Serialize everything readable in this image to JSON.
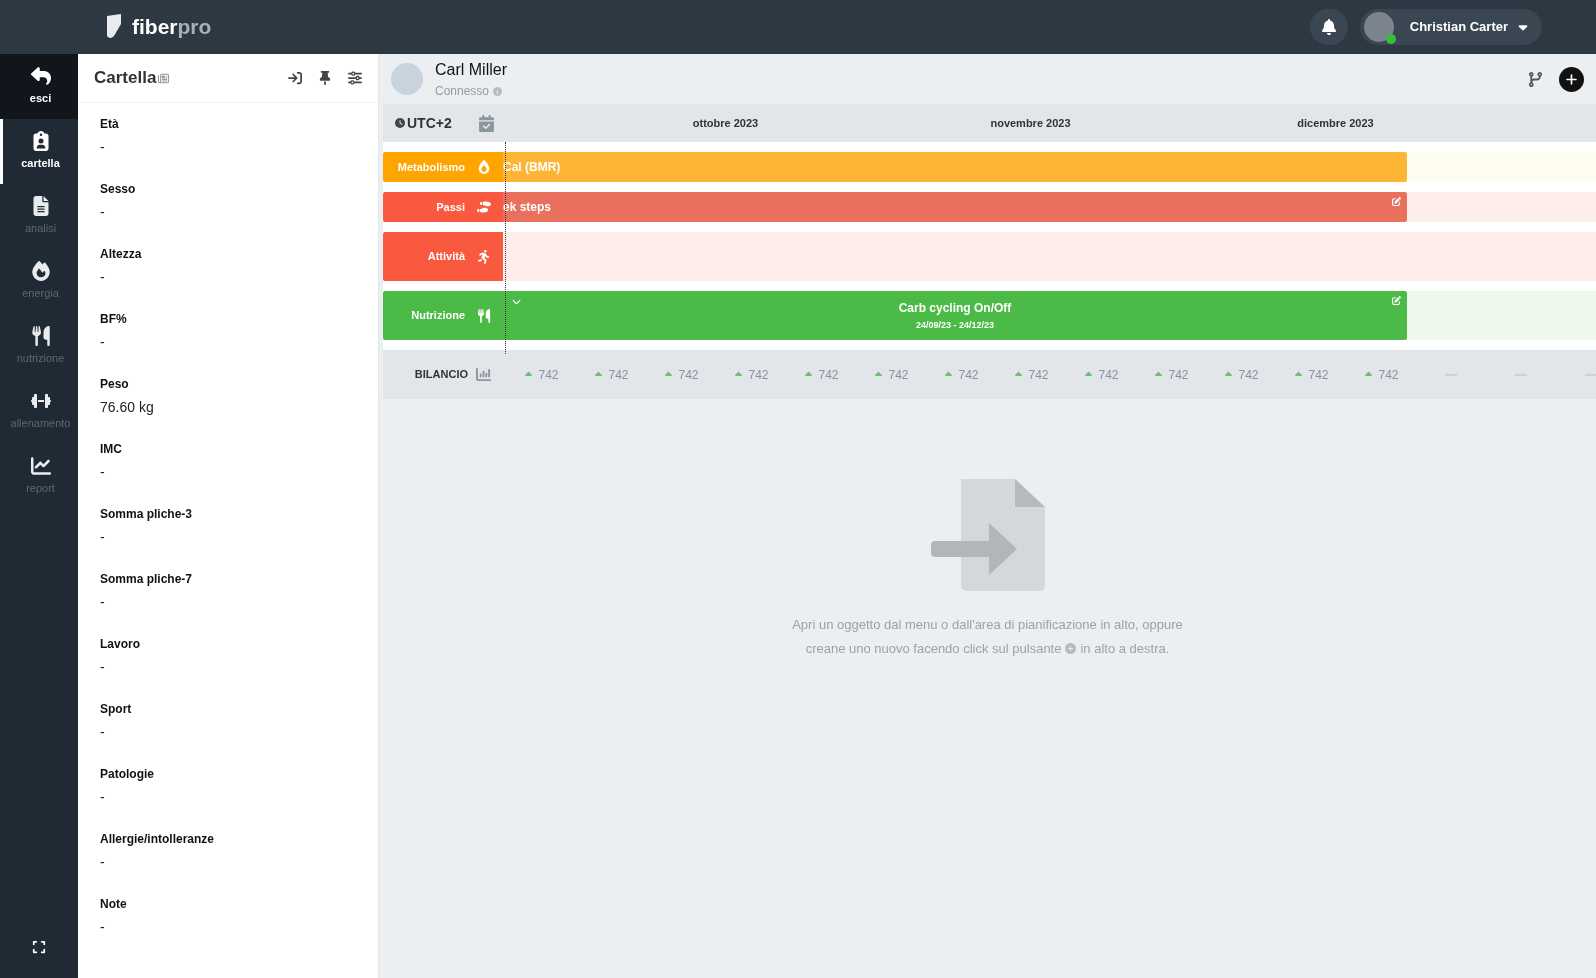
{
  "topbar": {
    "logo": {
      "strong": "fiber",
      "light": "pro"
    },
    "user": {
      "name": "Christian Carter",
      "online": true
    }
  },
  "rail": {
    "items": [
      {
        "label": "esci",
        "kind": "back",
        "selected": false
      },
      {
        "label": "cartella",
        "kind": "record",
        "selected": true
      },
      {
        "label": "analisi",
        "kind": "analysis",
        "selected": false
      },
      {
        "label": "energia",
        "kind": "energy",
        "selected": false
      },
      {
        "label": "nutrizione",
        "kind": "nutrition",
        "selected": false
      },
      {
        "label": "allenamento",
        "kind": "training",
        "selected": false
      },
      {
        "label": "report",
        "kind": "report",
        "selected": false
      }
    ]
  },
  "record": {
    "title": "Cartella",
    "fields": [
      {
        "label": "Età",
        "value": "-"
      },
      {
        "label": "Sesso",
        "value": "-"
      },
      {
        "label": "Altezza",
        "value": "-"
      },
      {
        "label": "BF%",
        "value": "-"
      },
      {
        "label": "Peso",
        "value": "76.60 kg"
      },
      {
        "label": "IMC",
        "value": "-"
      },
      {
        "label": "Somma pliche-3",
        "value": "-"
      },
      {
        "label": "Somma pliche-7",
        "value": "-"
      },
      {
        "label": "Lavoro",
        "value": "-"
      },
      {
        "label": "Sport",
        "value": "-"
      },
      {
        "label": "Patologie",
        "value": "-"
      },
      {
        "label": "Allergie/intolleranze",
        "value": "-"
      },
      {
        "label": "Note",
        "value": "-"
      }
    ]
  },
  "patient": {
    "name": "Carl Miller",
    "status": "Connesso"
  },
  "timeline": {
    "timezone": "UTC+2",
    "months": [
      "ottobre 2023",
      "novembre 2023",
      "dicembre 2023"
    ],
    "rows": [
      {
        "label": "Metabolismo",
        "kind": "metabolism",
        "color": "#ffa500",
        "bar": {
          "text": "Cal (BMR)",
          "editable": false
        }
      },
      {
        "label": "Passi",
        "kind": "steps",
        "color": "#f9593f",
        "bar": {
          "text": "ek steps",
          "editable": true
        }
      },
      {
        "label": "Attività",
        "kind": "activity",
        "color": "#f9593f"
      },
      {
        "label": "Nutrizione",
        "kind": "nutrition",
        "color": "#4cba47",
        "bar": {
          "text": "Carb cycling On/Off",
          "subtitle": "24/09/23 - 24/12/23",
          "editable": true,
          "expandable": true
        }
      }
    ],
    "balance": {
      "label": "BILANCIO",
      "cells": [
        {
          "kind": "value",
          "value": "742"
        },
        {
          "kind": "value",
          "value": "742"
        },
        {
          "kind": "value",
          "value": "742"
        },
        {
          "kind": "value",
          "value": "742"
        },
        {
          "kind": "value",
          "value": "742"
        },
        {
          "kind": "value",
          "value": "742"
        },
        {
          "kind": "value",
          "value": "742"
        },
        {
          "kind": "value",
          "value": "742"
        },
        {
          "kind": "value",
          "value": "742"
        },
        {
          "kind": "value",
          "value": "742"
        },
        {
          "kind": "value",
          "value": "742"
        },
        {
          "kind": "value",
          "value": "742"
        },
        {
          "kind": "value",
          "value": "742"
        },
        {
          "kind": "empty"
        },
        {
          "kind": "empty"
        },
        {
          "kind": "empty"
        }
      ]
    }
  },
  "empty_state": {
    "line1": "Apri un oggetto dal menu o dall'area di pianificazione in alto, oppure",
    "line2_before": "creane uno nuovo facendo click sul pulsante",
    "line2_after": "in alto a destra."
  }
}
